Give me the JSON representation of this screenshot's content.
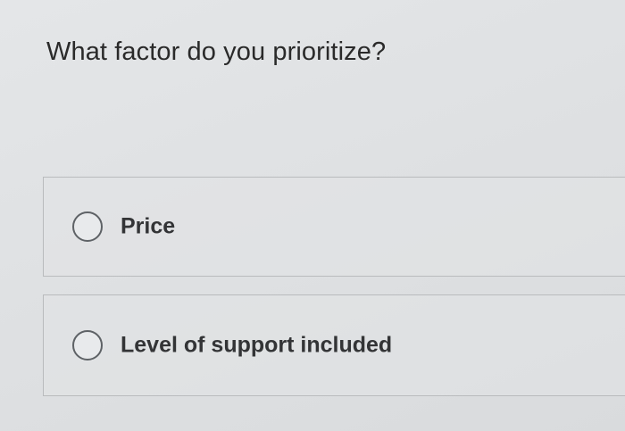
{
  "question": {
    "text": "What factor do you prioritize?"
  },
  "options": [
    {
      "label": "Price",
      "selected": false
    },
    {
      "label": "Level of support included",
      "selected": false
    }
  ]
}
